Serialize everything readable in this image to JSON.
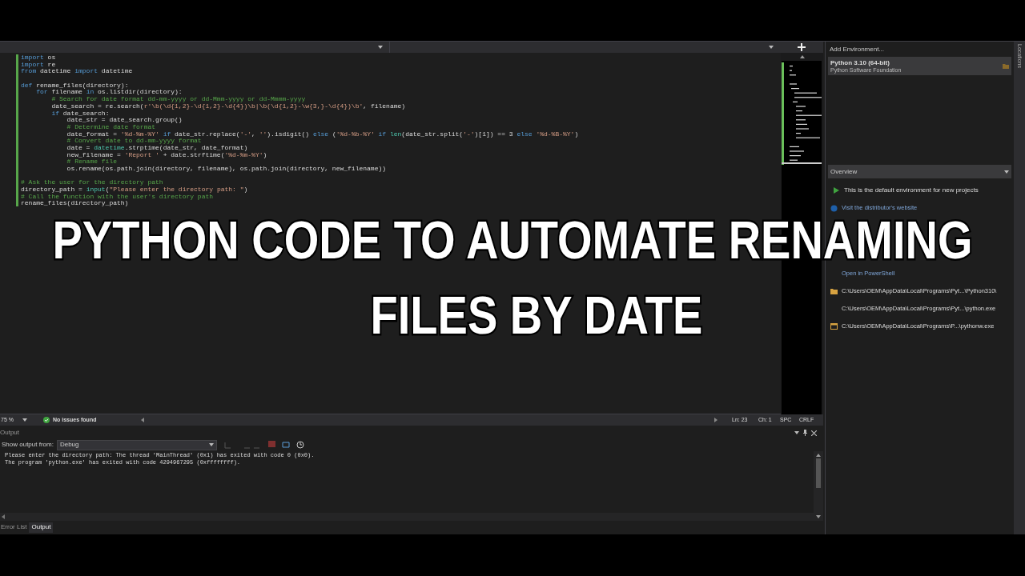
{
  "editor": {
    "code_lines": [
      {
        "segments": [
          {
            "text": "import",
            "kind": "kw"
          },
          {
            "text": " os",
            "kind": "pl"
          }
        ]
      },
      {
        "segments": [
          {
            "text": "import",
            "kind": "kw"
          },
          {
            "text": " re",
            "kind": "pl"
          }
        ]
      },
      {
        "segments": [
          {
            "text": "from",
            "kind": "kw"
          },
          {
            "text": " datetime ",
            "kind": "pl"
          },
          {
            "text": "import",
            "kind": "kw"
          },
          {
            "text": " datetime",
            "kind": "pl"
          }
        ]
      },
      {
        "kind": "blank"
      },
      {
        "segments": [
          {
            "text": "def",
            "kind": "kw"
          },
          {
            "text": " rename_files(directory):",
            "kind": "pl"
          }
        ]
      },
      {
        "segments": [
          {
            "text": "    for",
            "kind": "kw"
          },
          {
            "text": " filename ",
            "kind": "pl"
          },
          {
            "text": "in",
            "kind": "kw"
          },
          {
            "text": " os.listdir(directory):",
            "kind": "pl"
          }
        ]
      },
      {
        "segments": [
          {
            "text": "        # Search for date format dd-mm-yyyy or dd-Mmm-yyyy or dd-Mmmm-yyyy",
            "kind": "cm"
          }
        ]
      },
      {
        "segments": [
          {
            "text": "        date_search = re.search(",
            "kind": "pl"
          },
          {
            "text": "r'\\b(\\d{1,2}-\\d{1,2}-\\d{4})\\b|\\b(\\d{1,2}-\\w{3,}-\\d{4})\\b'",
            "kind": "str"
          },
          {
            "text": ", filename)",
            "kind": "pl"
          }
        ]
      },
      {
        "segments": [
          {
            "text": "        if",
            "kind": "kw"
          },
          {
            "text": " date_search:",
            "kind": "pl"
          }
        ]
      },
      {
        "segments": [
          {
            "text": "            date_str = date_search.group()",
            "kind": "pl"
          }
        ]
      },
      {
        "segments": [
          {
            "text": "            # Determine date format",
            "kind": "cm"
          }
        ]
      },
      {
        "segments": [
          {
            "text": "            date_format = ",
            "kind": "pl"
          },
          {
            "text": "'%d-%m-%Y'",
            "kind": "str"
          },
          {
            "text": " if",
            "kind": "kw"
          },
          {
            "text": " date_str.replace(",
            "kind": "pl"
          },
          {
            "text": "'-'",
            "kind": "str"
          },
          {
            "text": ", ",
            "kind": "pl"
          },
          {
            "text": "''",
            "kind": "str"
          },
          {
            "text": ").isdigit() ",
            "kind": "pl"
          },
          {
            "text": "else",
            "kind": "kw"
          },
          {
            "text": " (",
            "kind": "pl"
          },
          {
            "text": "'%d-%b-%Y'",
            "kind": "str"
          },
          {
            "text": " if",
            "kind": "kw"
          },
          {
            "text": " len",
            "kind": "cls"
          },
          {
            "text": "(date_str.split(",
            "kind": "pl"
          },
          {
            "text": "'-'",
            "kind": "str"
          },
          {
            "text": ")[1]) == 3 ",
            "kind": "pl"
          },
          {
            "text": "else",
            "kind": "kw"
          },
          {
            "text": " '%d-%B-%Y'",
            "kind": "str"
          },
          {
            "text": ")",
            "kind": "pl"
          }
        ]
      },
      {
        "segments": [
          {
            "text": "            # Convert date to dd-mm-yyyy format",
            "kind": "cm"
          }
        ]
      },
      {
        "segments": [
          {
            "text": "            date = ",
            "kind": "pl"
          },
          {
            "text": "datetime",
            "kind": "cls"
          },
          {
            "text": ".strptime(date_str, date_format)",
            "kind": "pl"
          }
        ]
      },
      {
        "segments": [
          {
            "text": "            new_filename = ",
            "kind": "pl"
          },
          {
            "text": "'Report '",
            "kind": "str"
          },
          {
            "text": " + date.strftime(",
            "kind": "pl"
          },
          {
            "text": "'%d-%m-%Y'",
            "kind": "str"
          },
          {
            "text": ")",
            "kind": "pl"
          }
        ]
      },
      {
        "segments": [
          {
            "text": "            # Rename file",
            "kind": "cm"
          }
        ]
      },
      {
        "segments": [
          {
            "text": "            os.rename(os.path.join(directory, filename), os.path.join(directory, new_filename))",
            "kind": "pl"
          }
        ]
      },
      {
        "kind": "blank"
      },
      {
        "segments": [
          {
            "text": "# Ask the user for the directory path",
            "kind": "cm"
          }
        ]
      },
      {
        "segments": [
          {
            "text": "directory_path = ",
            "kind": "pl"
          },
          {
            "text": "input",
            "kind": "cls"
          },
          {
            "text": "(",
            "kind": "pl"
          },
          {
            "text": "\"Please enter the directory path: \"",
            "kind": "str"
          },
          {
            "text": ")",
            "kind": "pl"
          }
        ]
      },
      {
        "segments": [
          {
            "text": "# Call the function with the user's directory path",
            "kind": "cm"
          }
        ]
      },
      {
        "segments": [
          {
            "text": "rename_files(directory_path)",
            "kind": "pl"
          }
        ]
      }
    ],
    "zoom": "75 %",
    "issues": "No issues found",
    "line": "Ln: 23",
    "column": "Ch: 1",
    "indent": "SPC",
    "line_ending": "CRLF"
  },
  "environments": {
    "add_label": "Add Environment...",
    "items": [
      {
        "name": "Python 3.10 (64-bit)",
        "publisher": "Python Software Foundation",
        "selected": true
      }
    ],
    "section": "Overview",
    "overview_items": [
      {
        "text": "This is the default environment for new projects",
        "kind": "default"
      },
      {
        "text": "Visit the distributor's website",
        "kind": "link"
      },
      {
        "text": "Open in PowerShell",
        "kind": "action"
      },
      {
        "text": "C:\\Users\\OEM\\AppData\\Local\\Programs\\Pyt...\\Python310\\",
        "kind": "folder"
      },
      {
        "text": "C:\\Users\\OEM\\AppData\\Local\\Programs\\Pyt...\\python.exe",
        "kind": "path"
      },
      {
        "text": "C:\\Users\\OEM\\AppData\\Local\\Programs\\P...\\pythonw.exe",
        "kind": "window"
      }
    ]
  },
  "side_tab": "Locations",
  "output": {
    "title": "Output",
    "source_label": "Show output from:",
    "source": "Debug",
    "lines": [
      "Please enter the directory path: The thread 'MainThread' (0x1) has exited with code 0 (0x0).",
      "The program 'python.exe' has exited with code 4294967295 (0xffffffff)."
    ]
  },
  "bottom_tabs": [
    {
      "label": "Error List",
      "selected": false
    },
    {
      "label": "Output",
      "selected": true
    }
  ],
  "overlay_title": {
    "lines": [
      "PYTHON CODE TO AUTOMATE RENAMING",
      "FILES BY DATE"
    ]
  }
}
